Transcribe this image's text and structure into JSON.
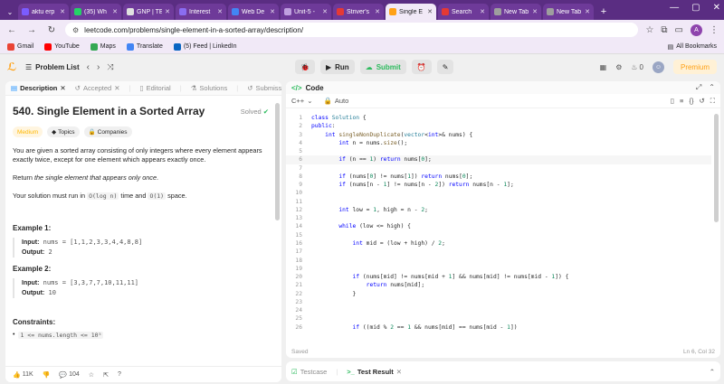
{
  "browser": {
    "tabs": [
      {
        "title": "aktu erp",
        "color": "#7b5cff"
      },
      {
        "title": "(35) Wh",
        "color": "#25d366"
      },
      {
        "title": "GNP | TE",
        "color": "#e0e0e0"
      },
      {
        "title": "Interest",
        "color": "#8a6df1"
      },
      {
        "title": "Web De",
        "color": "#4285f4"
      },
      {
        "title": "Unit-5 -",
        "color": "#c0a0e0"
      },
      {
        "title": "Striver's",
        "color": "#e53935"
      },
      {
        "title": "Single E",
        "color": "#ffa116"
      },
      {
        "title": "Search",
        "color": "#e53935"
      },
      {
        "title": "New Tab",
        "color": "#9e9e9e"
      },
      {
        "title": "New Tab",
        "color": "#9e9e9e"
      }
    ],
    "url": "leetcode.com/problems/single-element-in-a-sorted-array/description/",
    "bookmarks": [
      {
        "label": "Gmail",
        "color": "#ea4335"
      },
      {
        "label": "YouTube",
        "color": "#ff0000"
      },
      {
        "label": "Maps",
        "color": "#34a853"
      },
      {
        "label": "Translate",
        "color": "#4285f4"
      },
      {
        "label": "(5) Feed | LinkedIn",
        "color": "#0a66c2"
      }
    ],
    "all_bookmarks": "All Bookmarks",
    "avatar": "A"
  },
  "toolbar": {
    "problem_list": "Problem List",
    "run": "Run",
    "submit": "Submit",
    "streak": "0",
    "premium": "Premium"
  },
  "left": {
    "tabs": [
      "Description",
      "Accepted",
      "Editorial",
      "Solutions",
      "Submissions"
    ],
    "title": "540. Single Element in a Sorted Array",
    "solved": "Solved",
    "difficulty": "Medium",
    "topics": "Topics",
    "companies": "Companies",
    "p1": "You are given a sorted array consisting of only integers where every element appears exactly twice, except for one element which appears exactly once.",
    "p2_pre": "Return ",
    "p2_em": "the single element that appears only once",
    "p2_post": ".",
    "p3_pre": "Your solution must run in ",
    "p3_c1": "O(log n)",
    "p3_mid": " time and ",
    "p3_c2": "O(1)",
    "p3_post": " space.",
    "ex1_title": "Example 1:",
    "ex1_input_label": "Input:",
    "ex1_input": " nums = [1,1,2,3,3,4,4,8,8]",
    "ex1_output_label": "Output:",
    "ex1_output": " 2",
    "ex2_title": "Example 2:",
    "ex2_input_label": "Input:",
    "ex2_input": " nums = [3,3,7,7,10,11,11]",
    "ex2_output_label": "Output:",
    "ex2_output": " 10",
    "constraints_title": "Constraints:",
    "constraint1": "1 <= nums.length <= 10⁵",
    "likes": "11K",
    "comments": "104"
  },
  "code": {
    "header": "Code",
    "language": "C++",
    "auto": "Auto",
    "lines": [
      {
        "n": "1",
        "t": "class Solution {"
      },
      {
        "n": "2",
        "t": "public:"
      },
      {
        "n": "3",
        "t": "    int singleNonDuplicate(vector<int>& nums) {"
      },
      {
        "n": "4",
        "t": "        int n = nums.size();"
      },
      {
        "n": "5",
        "t": ""
      },
      {
        "n": "6",
        "t": "        if (n == 1) return nums[0];"
      },
      {
        "n": "7",
        "t": ""
      },
      {
        "n": "8",
        "t": "        if (nums[0] != nums[1]) return nums[0];"
      },
      {
        "n": "9",
        "t": "        if (nums[n - 1] != nums[n - 2]) return nums[n - 1];"
      },
      {
        "n": "10",
        "t": ""
      },
      {
        "n": "11",
        "t": ""
      },
      {
        "n": "12",
        "t": "        int low = 1, high = n - 2;"
      },
      {
        "n": "13",
        "t": ""
      },
      {
        "n": "14",
        "t": "        while (low <= high) {"
      },
      {
        "n": "15",
        "t": ""
      },
      {
        "n": "16",
        "t": "            int mid = (low + high) / 2;"
      },
      {
        "n": "17",
        "t": ""
      },
      {
        "n": "18",
        "t": ""
      },
      {
        "n": "19",
        "t": ""
      },
      {
        "n": "20",
        "t": "            if (nums[mid] != nums[mid + 1] && nums[mid] != nums[mid - 1]) {"
      },
      {
        "n": "21",
        "t": "                return nums[mid];"
      },
      {
        "n": "22",
        "t": "            }"
      },
      {
        "n": "23",
        "t": ""
      },
      {
        "n": "24",
        "t": ""
      },
      {
        "n": "25",
        "t": ""
      },
      {
        "n": "26",
        "t": "            if ((mid % 2 == 1 && nums[mid] == nums[mid - 1])"
      }
    ],
    "status": "Saved",
    "cursor": "Ln 6, Col 32"
  },
  "bottom": {
    "testcase": "Testcase",
    "test_result": "Test Result"
  }
}
